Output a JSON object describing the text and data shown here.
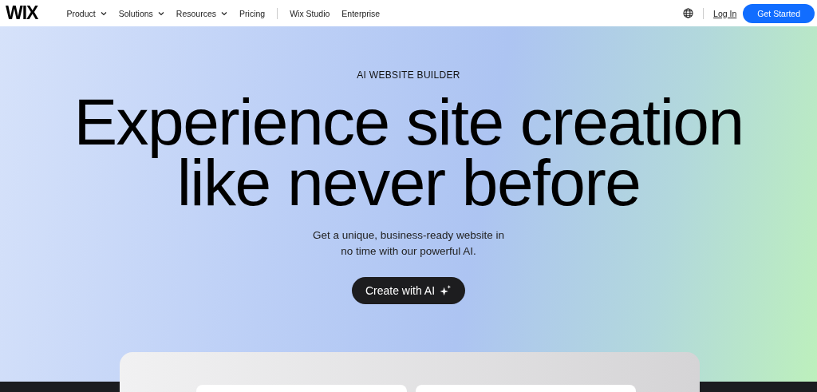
{
  "header": {
    "logo": "WIX",
    "nav": [
      {
        "label": "Product",
        "has_menu": true
      },
      {
        "label": "Solutions",
        "has_menu": true
      },
      {
        "label": "Resources",
        "has_menu": true
      },
      {
        "label": "Pricing",
        "has_menu": false
      },
      {
        "label": "Wix Studio",
        "has_menu": false,
        "divider_before": true
      },
      {
        "label": "Enterprise",
        "has_menu": false
      }
    ],
    "login": "Log In",
    "cta": "Get Started"
  },
  "hero": {
    "eyebrow": "AI WEBSITE BUILDER",
    "headline_lines": [
      "Experience site creation",
      "like never before"
    ],
    "subtitle_lines": [
      "Get a unique, business-ready website in",
      "no time with our powerful AI."
    ],
    "button": "Create with AI"
  }
}
